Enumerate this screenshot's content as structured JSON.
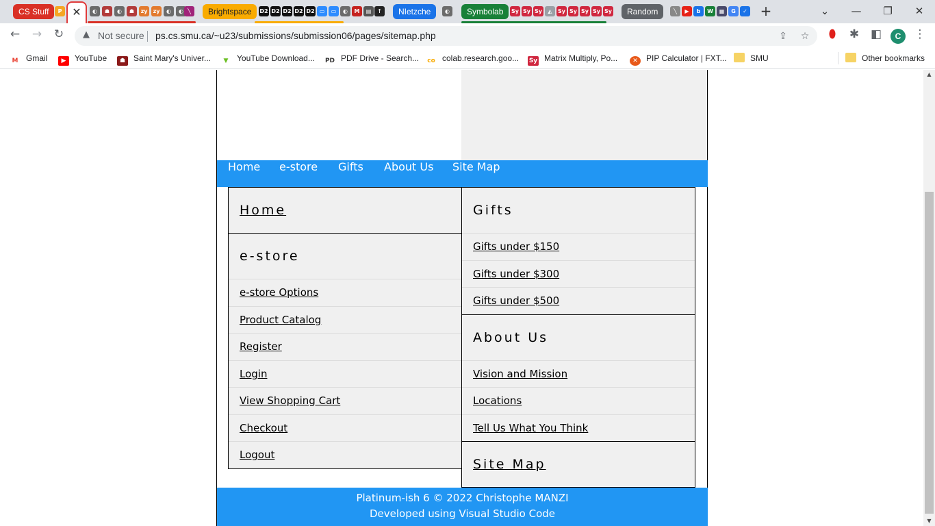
{
  "browser": {
    "tab_groups": [
      {
        "label": "CS Stuff",
        "color": "#d93025"
      },
      {
        "label": "Brightspace",
        "color": "#f9ab00"
      },
      {
        "label": "NIetzche",
        "color": "#1a73e8"
      },
      {
        "label": "Symbolab",
        "color": "#188038"
      },
      {
        "label": "Random",
        "color": "#5f6368"
      }
    ],
    "active_tab_close": "✕",
    "new_tab": "+",
    "window_controls": {
      "dropdown": "⌄",
      "minimize": "—",
      "restore": "❐",
      "close": "✕"
    },
    "address": {
      "security_label": "Not secure",
      "url": "ps.cs.smu.ca/~u23/submissions/submission06/pages/sitemap.php"
    },
    "profile_initial": "C",
    "bookmarks": [
      {
        "label": "Gmail",
        "icon": "gmail-icon"
      },
      {
        "label": "YouTube",
        "icon": "youtube-icon"
      },
      {
        "label": "Saint Mary's Univer...",
        "icon": "smu-crest-icon"
      },
      {
        "label": "YouTube Download...",
        "icon": "download-arrow-icon"
      },
      {
        "label": "PDF Drive - Search...",
        "icon": "pdf-drive-icon"
      },
      {
        "label": "colab.research.goo...",
        "icon": "colab-icon"
      },
      {
        "label": "Matrix Multiply, Po...",
        "icon": "symbolab-icon"
      },
      {
        "label": "PIP Calculator | FXT...",
        "icon": "pip-calculator-icon"
      },
      {
        "label": "SMU",
        "icon": "folder-icon"
      }
    ],
    "other_bookmarks": "Other bookmarks"
  },
  "page": {
    "nav": [
      "Home",
      "e-store",
      "Gifts",
      "About Us",
      "Site Map"
    ],
    "sitemap": {
      "home": "Home",
      "estore": {
        "heading": "e-store",
        "items": [
          "e-store Options",
          "Product Catalog",
          "Register",
          "Login",
          "View Shopping Cart",
          "Checkout",
          "Logout"
        ]
      },
      "gifts": {
        "heading": "Gifts",
        "items": [
          "Gifts under $150",
          "Gifts under $300",
          "Gifts under $500"
        ]
      },
      "about": {
        "heading": "About Us",
        "items": [
          "Vision and Mission",
          "Locations",
          "Tell Us What You Think"
        ]
      },
      "site_map": "Site Map"
    },
    "footer": {
      "line1": "Platinum-ish 6 © 2022 Christophe MANZI",
      "line2": "Developed using Visual Studio Code"
    }
  },
  "colors": {
    "nav_blue": "#2196f3",
    "panel_gray": "#f0f0f0"
  }
}
